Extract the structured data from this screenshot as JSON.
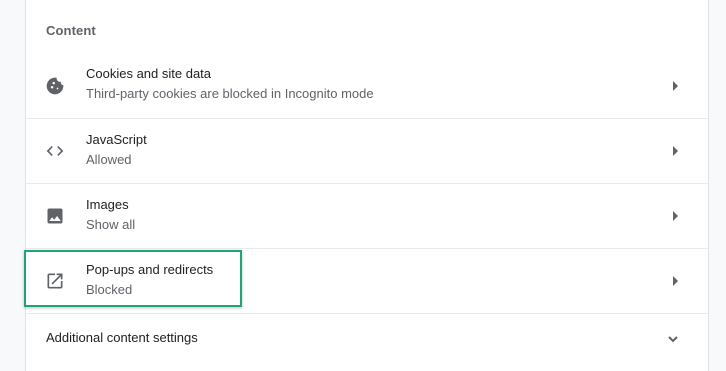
{
  "section": {
    "title": "Content"
  },
  "rows": [
    {
      "icon": "cookie-icon",
      "label": "Cookies and site data",
      "sublabel": "Third-party cookies are blocked in Incognito mode"
    },
    {
      "icon": "code-icon",
      "label": "JavaScript",
      "sublabel": "Allowed"
    },
    {
      "icon": "image-icon",
      "label": "Images",
      "sublabel": "Show all"
    },
    {
      "icon": "open-in-new-icon",
      "label": "Pop-ups and redirects",
      "sublabel": "Blocked"
    }
  ],
  "additional": {
    "label": "Additional content settings",
    "icon": "chevron-down-icon"
  },
  "colors": {
    "highlight": "#21a37a",
    "icon": "#5f6368",
    "primary_text": "#202124",
    "secondary_text": "#5f6368"
  }
}
